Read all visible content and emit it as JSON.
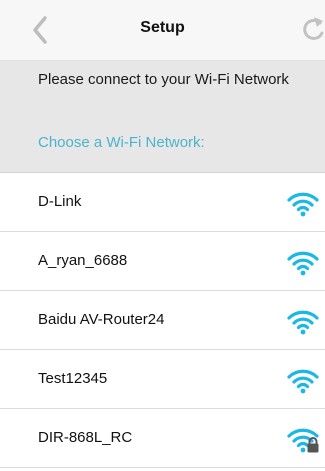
{
  "navbar": {
    "title": "Setup",
    "back_icon": "chevron-left-icon",
    "refresh_icon": "refresh-icon"
  },
  "header": {
    "instruction": "Please connect to your Wi-Fi Network",
    "subheading": "Choose a Wi-Fi Network:"
  },
  "networks": [
    {
      "name": "D-Link",
      "icon": "wifi-icon",
      "secured": false
    },
    {
      "name": "A_ryan_6688",
      "icon": "wifi-icon",
      "secured": false
    },
    {
      "name": "Baidu AV-Router24",
      "icon": "wifi-icon",
      "secured": false
    },
    {
      "name": "Test12345",
      "icon": "wifi-icon",
      "secured": false
    },
    {
      "name": "DIR-868L_RC",
      "icon": "wifi-lock-icon",
      "secured": true
    }
  ],
  "colors": {
    "accent": "#4bb4cc",
    "wifi": "#1ab8e6",
    "header_bg": "#e7e7e7",
    "navbar_bg": "#f7f7f7",
    "icon_gray": "#c2c2c2"
  }
}
